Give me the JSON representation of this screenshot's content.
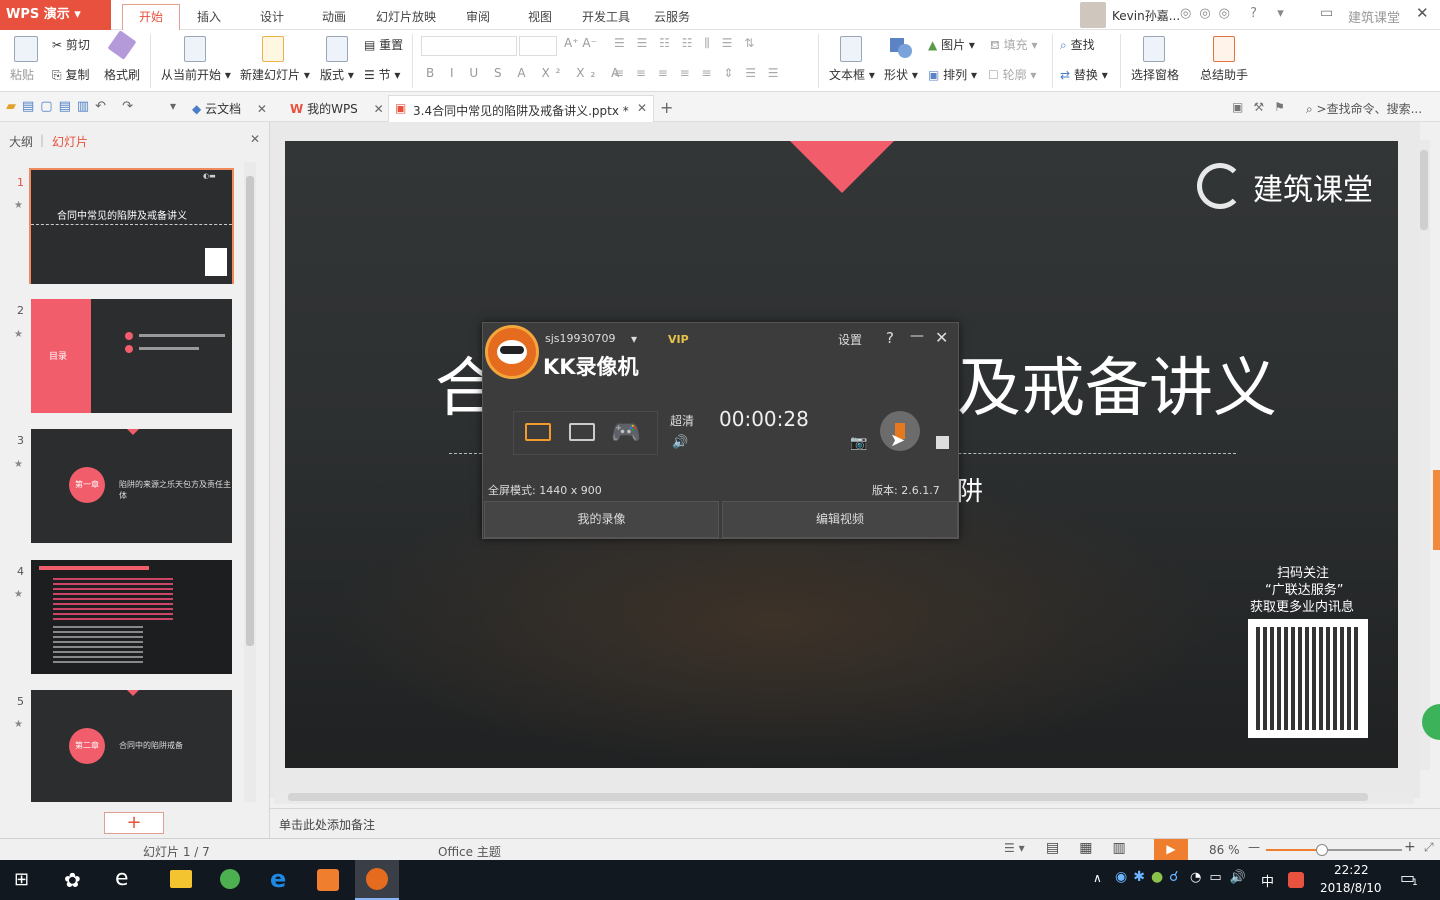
{
  "titlebar": {
    "app": "WPS 演示",
    "tabs": [
      "开始",
      "插入",
      "设计",
      "动画",
      "幻灯片放映",
      "审阅",
      "视图",
      "开发工具",
      "云服务"
    ],
    "user": "Kevin孙嘉...",
    "watermark": "建筑课堂"
  },
  "ribbon": {
    "paste": "粘贴",
    "cut": "剪切",
    "copy": "复制",
    "format_brush": "格式刷",
    "from_current": "从当前开始",
    "new_slide": "新建幻灯片",
    "layout": "版式",
    "section": "节",
    "reset": "重置",
    "text_box": "文本框",
    "shape": "形状",
    "picture": "图片",
    "fill": "填充",
    "arrange": "排列",
    "outline": "轮廓",
    "find": "查找",
    "replace": "替换",
    "selection_pane": "选择窗格",
    "summary_assistant": "总结助手"
  },
  "docbar": {
    "cloud_doc": "云文档",
    "my_wps": "我的WPS",
    "doc_title": "3.4合同中常见的陷阱及戒备讲义.pptx *",
    "search_placeholder": "查找命令、搜索..."
  },
  "leftpanel": {
    "tab_outline": "大纲",
    "tab_slides": "幻灯片",
    "thumbs": [
      {
        "num": "1",
        "title": "合同中常见的陷阱及戒备讲义"
      },
      {
        "num": "2",
        "menu": "目录"
      },
      {
        "num": "3",
        "chapter": "第一章",
        "text": "陷阱的来源之乐天包方及责任主体"
      },
      {
        "num": "4"
      },
      {
        "num": "5",
        "chapter": "第二章",
        "text": "合同中的陷阱戒备"
      }
    ]
  },
  "slide": {
    "logo": "建筑课堂",
    "title_left": "合",
    "title_right": "及戒备讲义",
    "subtitle_tail": "阱",
    "qr_line1": "扫码关注",
    "qr_line2": "“广联达服务”",
    "qr_line3": "获取更多业内讯息"
  },
  "kk": {
    "account": "sjs19930709",
    "vip": "VIP",
    "settings": "设置",
    "help": "?",
    "app_name": "KK录像机",
    "quality": "超清",
    "timer": "00:00:28",
    "mode": "全屏模式: 1440 x 900",
    "version": "版本: 2.6.1.7",
    "my_recordings": "我的录像",
    "edit_video": "编辑视频"
  },
  "notes": {
    "placeholder": "单击此处添加备注"
  },
  "status": {
    "slide_count": "幻灯片 1 / 7",
    "theme": "Office 主题",
    "zoom": "86 %"
  },
  "taskbar": {
    "time": "22:22",
    "date": "2018/8/10",
    "ime": "中",
    "notif": "1"
  }
}
